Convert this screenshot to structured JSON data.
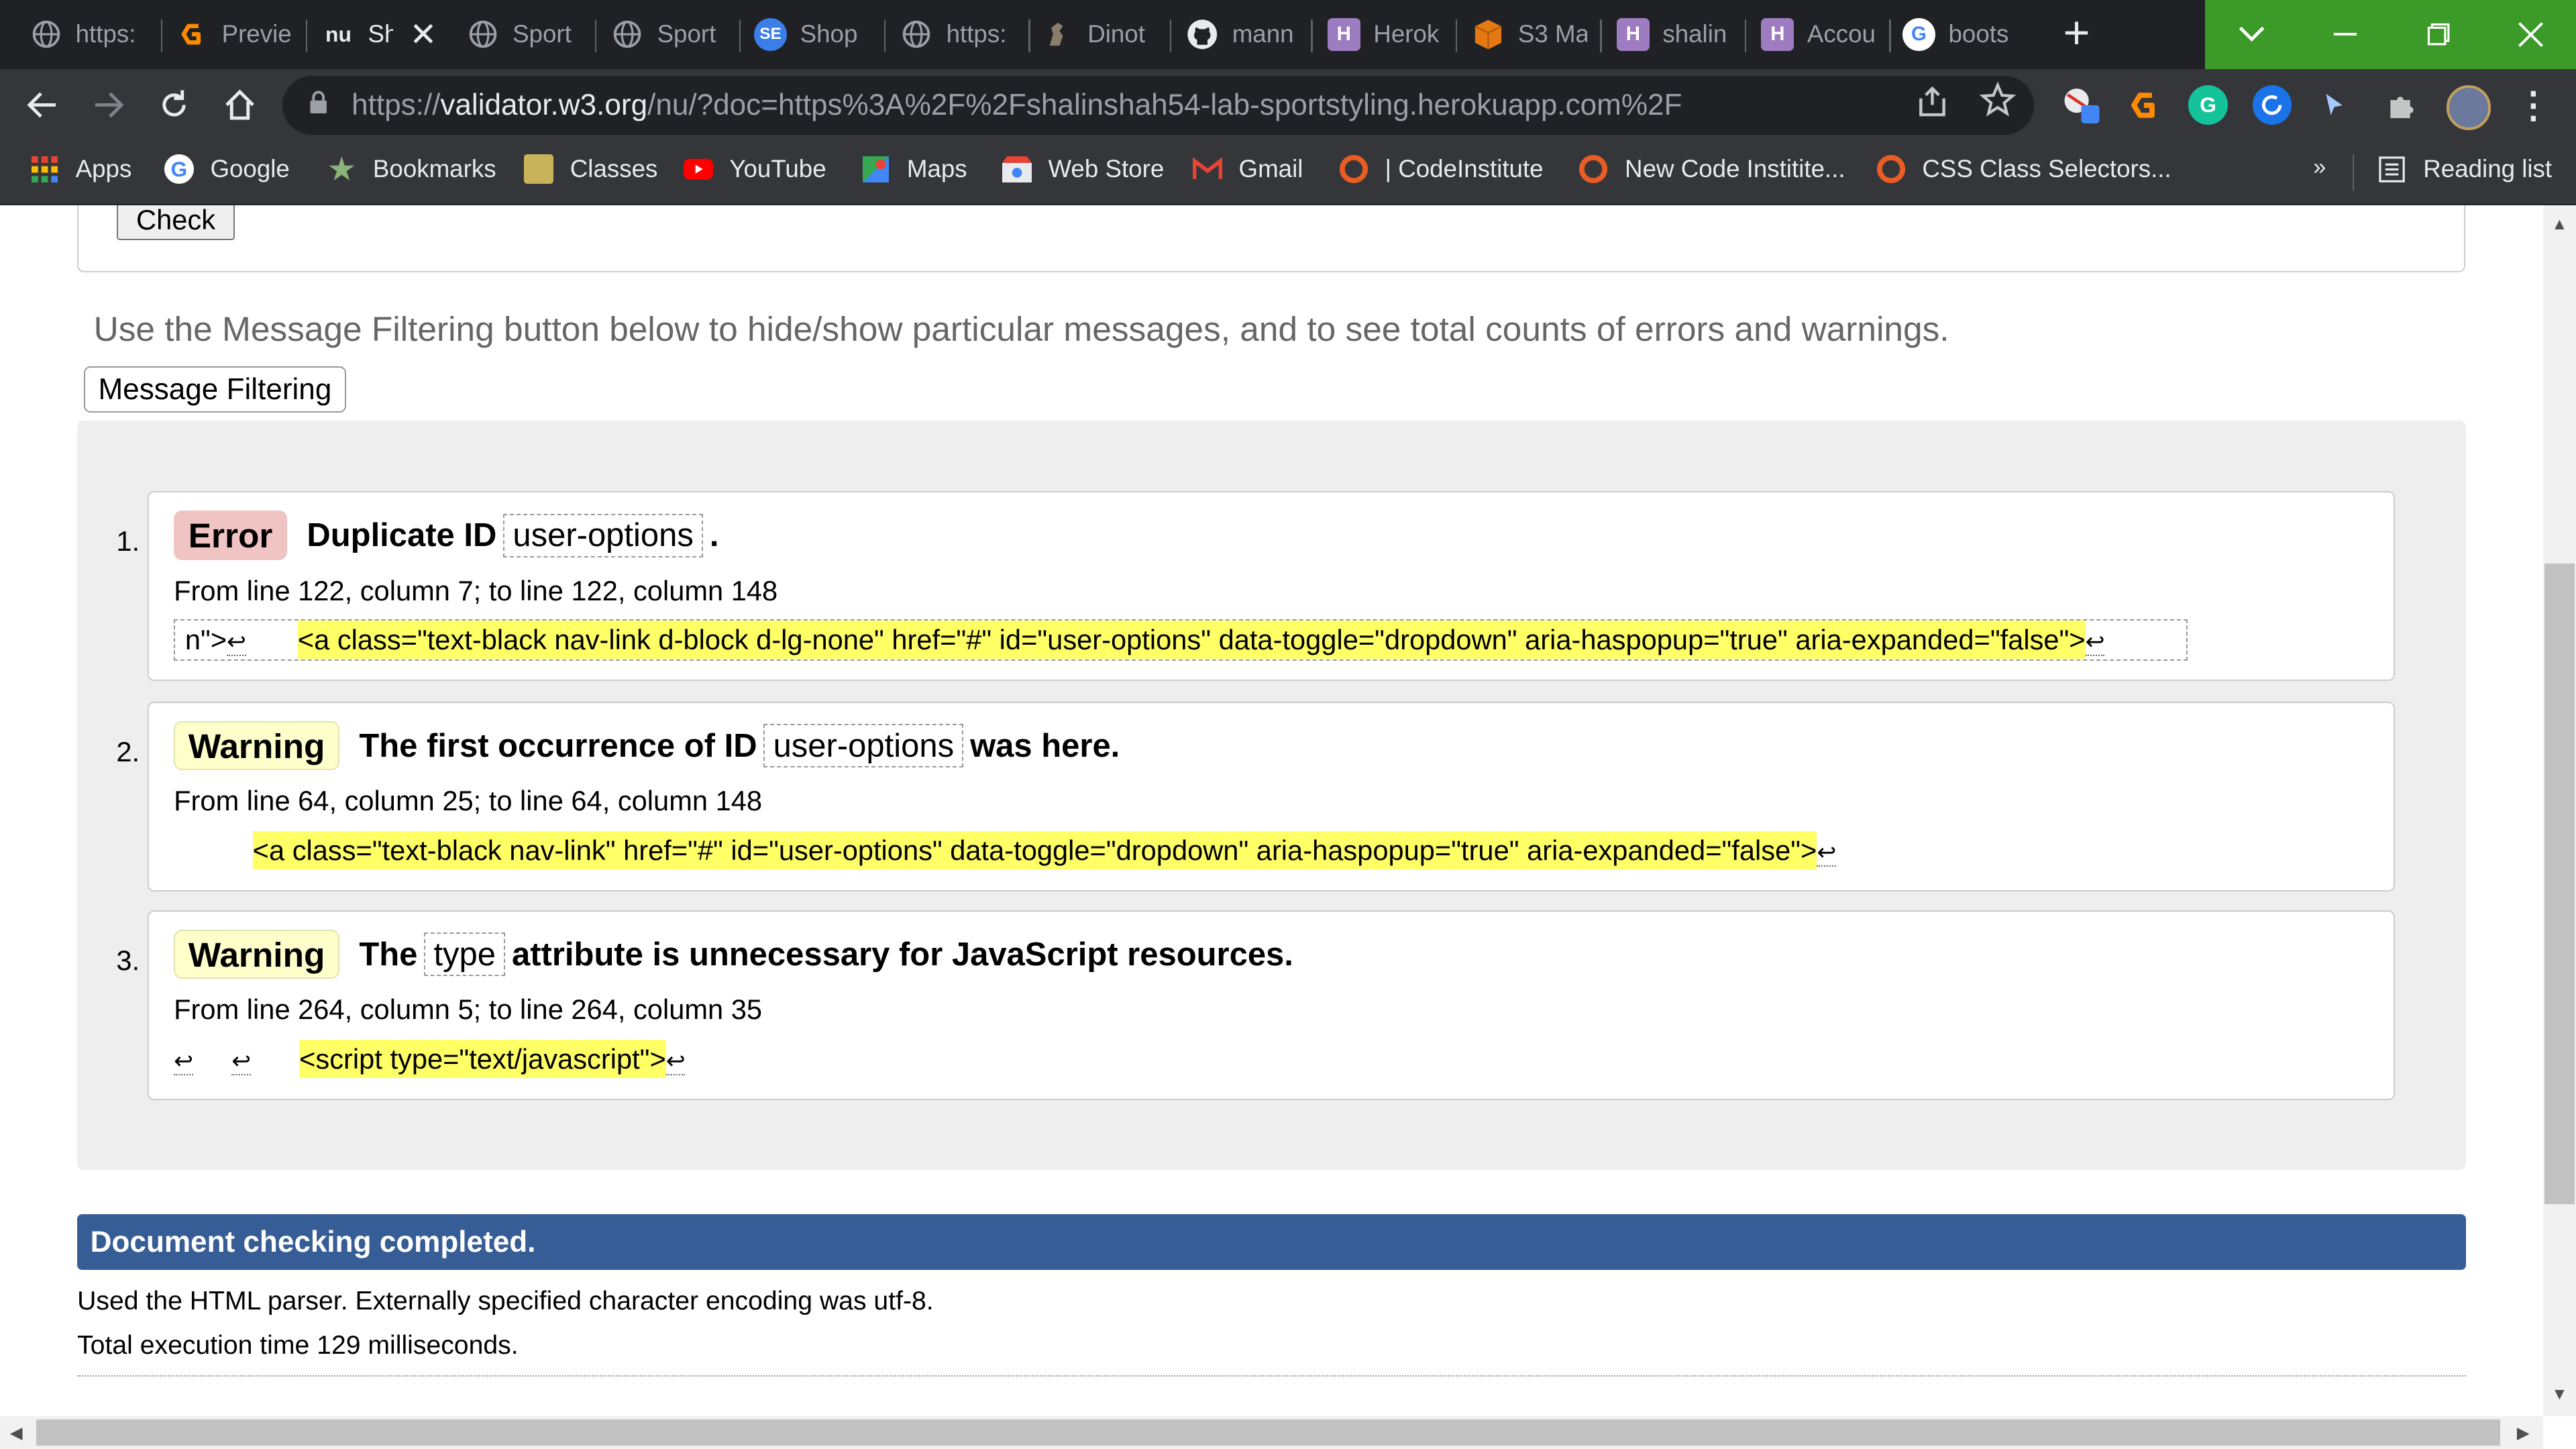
{
  "browser": {
    "tabs": [
      {
        "title": "https:",
        "icon": "globe-icon",
        "active": false
      },
      {
        "title": "Previe",
        "icon": "gitpod-icon",
        "active": false
      },
      {
        "title": "Sh",
        "icon": "nu-validator-icon",
        "active": true,
        "icon_text": "nu"
      },
      {
        "title": "Sport",
        "icon": "globe-icon",
        "active": false
      },
      {
        "title": "Sport",
        "icon": "globe-icon",
        "active": false
      },
      {
        "title": "Shop",
        "icon": "shop-icon",
        "active": false,
        "icon_text": "SE"
      },
      {
        "title": "https:",
        "icon": "globe-icon",
        "active": false
      },
      {
        "title": "Dinot",
        "icon": "dino-icon",
        "active": false
      },
      {
        "title": "mann",
        "icon": "github-icon",
        "active": false
      },
      {
        "title": "Herok",
        "icon": "heroku-icon",
        "active": false,
        "icon_text": "H"
      },
      {
        "title": "S3 Ma",
        "icon": "aws-icon",
        "active": false
      },
      {
        "title": "shalin",
        "icon": "heroku-icon",
        "active": false,
        "icon_text": "H"
      },
      {
        "title": "Accou",
        "icon": "heroku-icon",
        "active": false,
        "icon_text": "H"
      },
      {
        "title": "boots",
        "icon": "google-icon",
        "active": false,
        "icon_text": "G"
      }
    ],
    "new_tab": "+",
    "url_prefix": "https://",
    "url_host": "validator.w3.org",
    "url_path": "/nu/?doc=https%3A%2F%2Fshalinshah54-lab-sportstyling.herokuapp.com%2F",
    "bookmarks": [
      {
        "label": "Apps",
        "icon": "apps-grid-icon"
      },
      {
        "label": "Google",
        "icon": "google-icon"
      },
      {
        "label": "Bookmarks",
        "icon": "star-icon"
      },
      {
        "label": "Classes",
        "icon": "classes-icon"
      },
      {
        "label": "YouTube",
        "icon": "youtube-icon"
      },
      {
        "label": "Maps",
        "icon": "maps-icon"
      },
      {
        "label": "Web Store",
        "icon": "webstore-icon"
      },
      {
        "label": "Gmail",
        "icon": "gmail-icon"
      },
      {
        "label": "| CodeInstitute",
        "icon": "codeinstitute-icon"
      },
      {
        "label": "New Code Institite...",
        "icon": "codeinstitute-icon"
      },
      {
        "label": "CSS Class Selectors...",
        "icon": "codeinstitute-icon"
      }
    ],
    "bookmarks_more": "»",
    "reading_list": "Reading list"
  },
  "page": {
    "check_button": "Check",
    "filter_help": "Use the Message Filtering button below to hide/show particular messages, and to see total counts of errors and warnings.",
    "filter_button": "Message Filtering",
    "messages": [
      {
        "number": "1.",
        "type": "Error",
        "text_before": "Duplicate ID",
        "code": "user-options",
        "text_after": ".",
        "location": "From line 122, column 7; to line 122, column 148",
        "extract_prefix": "n\">",
        "extract_highlight": "<a class=\"text-black nav-link d-block d-lg-none\" href=\"#\" id=\"user-options\" data-toggle=\"dropdown\" aria-haspopup=\"true\" aria-expanded=\"false\">"
      },
      {
        "number": "2.",
        "type": "Warning",
        "text_before": "The first occurrence of ID",
        "code": "user-options",
        "text_after": "was here.",
        "location": "From line 64, column 25; to line 64, column 148",
        "extract_prefix": "",
        "extract_highlight": "<a class=\"text-black nav-link\" href=\"#\" id=\"user-options\" data-toggle=\"dropdown\" aria-haspopup=\"true\" aria-expanded=\"false\">"
      },
      {
        "number": "3.",
        "type": "Warning",
        "text_before": "The",
        "code": "type",
        "text_after": "attribute is unnecessary for JavaScript resources.",
        "location": "From line 264, column 5; to line 264, column 35",
        "extract_prefix": "",
        "extract_highlight": "<script type=\"text/javascript\">"
      }
    ],
    "return_glyph": "↩",
    "completed": "Document checking completed.",
    "parser_info": "Used the HTML parser. Externally specified character encoding was utf-8.",
    "exec_time": "Total execution time 129 milliseconds."
  },
  "colors": {
    "tabstrip": "#202124",
    "toolbar": "#35363a",
    "window_controls": "#3c9a28",
    "error_badge": "#f1c4c4",
    "warning_badge": "#ffffcc",
    "highlight": "#ffff66",
    "completed_bar": "#365d95"
  }
}
